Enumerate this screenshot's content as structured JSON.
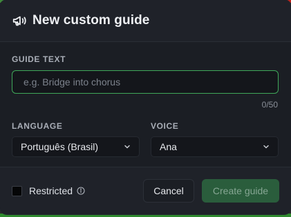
{
  "dialog": {
    "title": "New custom guide",
    "icon": "megaphone-icon"
  },
  "guide_text": {
    "label": "GUIDE TEXT",
    "placeholder": "e.g. Bridge into chorus",
    "value": "",
    "counter": "0/50"
  },
  "language": {
    "label": "LANGUAGE",
    "selected": "Português (Brasil)"
  },
  "voice": {
    "label": "VOICE",
    "selected": "Ana"
  },
  "footer": {
    "restricted_label": "Restricted",
    "restricted_checked": false,
    "cancel_label": "Cancel",
    "create_label": "Create guide"
  },
  "colors": {
    "accent": "#3fa85a",
    "create_button_disabled": "#2a5d3c",
    "dialog_bg": "#1b1e24"
  }
}
